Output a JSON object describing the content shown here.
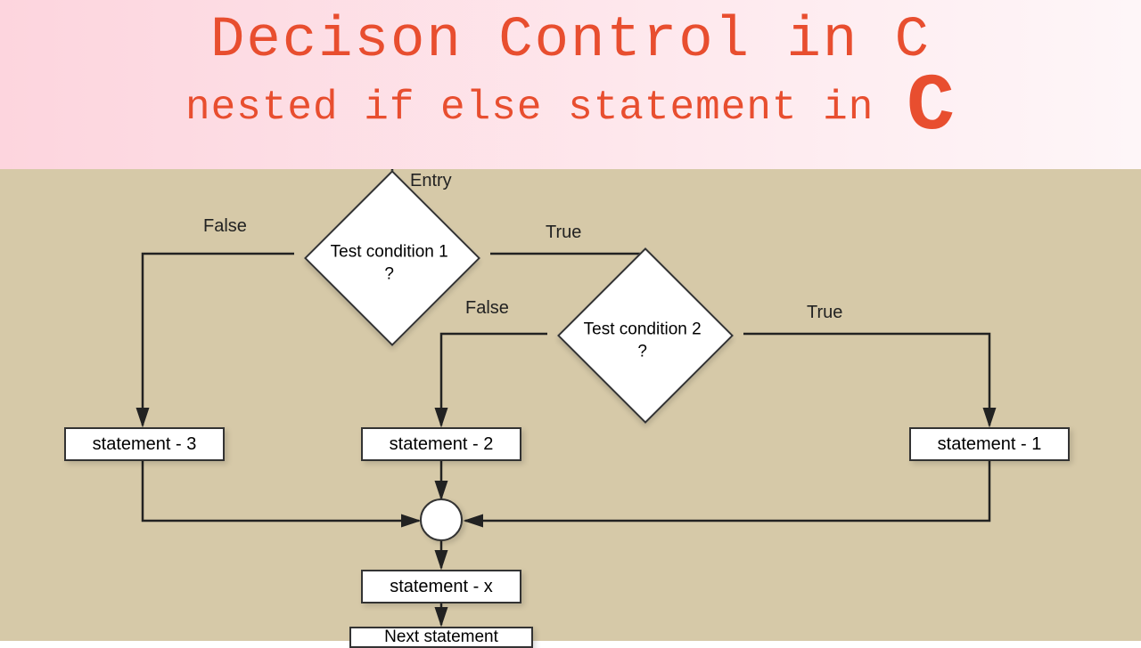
{
  "header": {
    "title_main": "Decison Control in C",
    "title_sub_prefix": "nested if else statement in ",
    "title_sub_big": "C"
  },
  "diagram": {
    "entry_label": "Entry",
    "cond1": {
      "text": "Test condition 1\n?",
      "true_label": "True",
      "false_label": "False"
    },
    "cond2": {
      "text": "Test condition 2\n?",
      "true_label": "True",
      "false_label": "False"
    },
    "stmt1": "statement - 1",
    "stmt2": "statement - 2",
    "stmt3": "statement - 3",
    "stmt_x": "statement - x",
    "next": "Next statement"
  }
}
